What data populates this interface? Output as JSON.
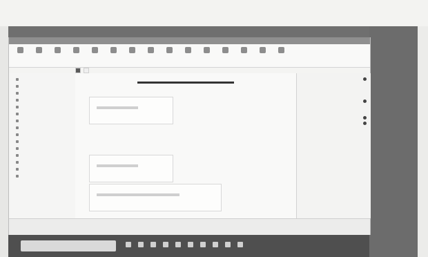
{
  "ribbon_tabs": [
    "",
    "",
    "",
    "",
    "",
    "",
    ""
  ],
  "ribbon_buttons": [
    {
      "label": ""
    },
    {
      "label": ""
    },
    {
      "label": ""
    },
    {
      "label": ""
    },
    {
      "label": ""
    },
    {
      "label": ""
    },
    {
      "label": ""
    },
    {
      "label": ""
    },
    {
      "label": ""
    },
    {
      "label": ""
    },
    {
      "label": ""
    },
    {
      "label": ""
    },
    {
      "label": ""
    },
    {
      "label": ""
    },
    {
      "label": ""
    }
  ],
  "doc_tabs": [
    {
      "label": ""
    },
    {
      "label": ""
    }
  ],
  "left_panel": {
    "title": "",
    "items": [
      {
        "label": ""
      },
      {
        "label": ""
      },
      {
        "label": ""
      },
      {
        "label": ""
      },
      {
        "label": ""
      },
      {
        "label": ""
      },
      {
        "label": ""
      },
      {
        "label": ""
      },
      {
        "label": ""
      },
      {
        "label": ""
      },
      {
        "label": ""
      },
      {
        "label": ""
      },
      {
        "label": ""
      },
      {
        "label": ""
      },
      {
        "label": ""
      }
    ]
  },
  "center": {
    "block_1_title": "",
    "block_2_title": "",
    "block_3_title": ""
  },
  "props": {
    "title": "",
    "rows": [
      {
        "label": ""
      },
      {
        "label": ""
      },
      {
        "label": ""
      },
      {
        "label": ""
      },
      {
        "label": ""
      },
      {
        "label": ""
      },
      {
        "label": ""
      },
      {
        "label": ""
      },
      {
        "label": ""
      },
      {
        "label": ""
      },
      {
        "label": ""
      },
      {
        "label": ""
      }
    ]
  },
  "status": {
    "left": "",
    "mid": "",
    "right": ""
  },
  "taskbar": {
    "search_placeholder": "",
    "tray_time": ""
  }
}
